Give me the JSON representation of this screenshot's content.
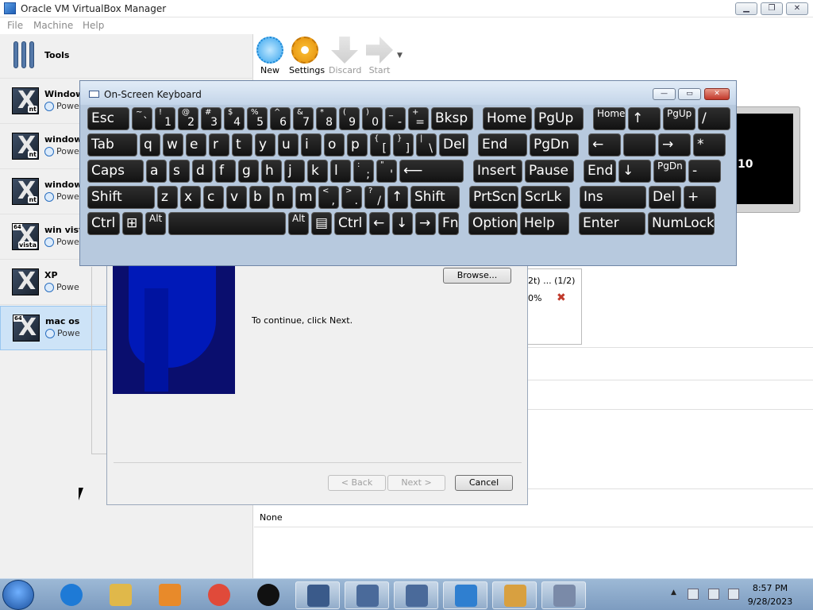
{
  "window": {
    "title": "Oracle VM VirtualBox Manager",
    "btn_min": "▁",
    "btn_max": "❐",
    "btn_close": "✕"
  },
  "menu": [
    "File",
    "Machine",
    "Help"
  ],
  "sidebar": {
    "tools_label": "Tools",
    "vms": [
      {
        "name": "Window",
        "state": "Powe",
        "badge": "nt",
        "bit": ""
      },
      {
        "name": "windows",
        "state": "Powe",
        "badge": "nt",
        "bit": ""
      },
      {
        "name": "windows",
        "state": "Powe",
        "badge": "nt",
        "bit": ""
      },
      {
        "name": "win vist",
        "state": "Powe",
        "badge": "vista",
        "bit": "64"
      },
      {
        "name": "XP",
        "state": "Powe",
        "badge": "",
        "bit": ""
      },
      {
        "name": "mac os",
        "state": "Powe",
        "badge": "",
        "bit": "64"
      }
    ]
  },
  "toolbar": {
    "new": "New",
    "settings": "Settings",
    "discard": "Discard",
    "start": "Start"
  },
  "preview": {
    "text": "10"
  },
  "downloads": {
    "progress_label": "2t) ... (1/2)",
    "percent": "0%",
    "cancel_icon": "✖"
  },
  "details": {
    "none_label": "None"
  },
  "wizard": {
    "browse": "Browse...",
    "instruction": "To continue, click Next.",
    "back": "< Back",
    "next": "Next >",
    "cancel": "Cancel"
  },
  "osk": {
    "title": "On-Screen Keyboard",
    "btn_min": "—",
    "btn_max": "▭",
    "btn_close": "✕",
    "row1": [
      {
        "t": "Esc"
      },
      {
        "sub": "~",
        "main": "`"
      },
      {
        "sub": "!",
        "main": "1"
      },
      {
        "sub": "@",
        "main": "2"
      },
      {
        "sub": "#",
        "main": "3"
      },
      {
        "sub": "$",
        "main": "4"
      },
      {
        "sub": "%",
        "main": "5"
      },
      {
        "sub": "^",
        "main": "6"
      },
      {
        "sub": "&",
        "main": "7"
      },
      {
        "sub": "*",
        "main": "8"
      },
      {
        "sub": "(",
        "main": "9"
      },
      {
        "sub": ")",
        "main": "0"
      },
      {
        "sub": "_",
        "main": "-"
      },
      {
        "sub": "+",
        "main": "="
      },
      {
        "t": "Bksp"
      },
      {
        "t": "Home"
      },
      {
        "t": "PgUp"
      },
      {
        "t": "Home",
        "sm": true
      },
      {
        "t": "↑"
      },
      {
        "t": "PgUp",
        "sm": true
      },
      {
        "t": "/"
      }
    ],
    "row2": [
      {
        "t": "Tab"
      },
      {
        "t": "q"
      },
      {
        "t": "w"
      },
      {
        "t": "e"
      },
      {
        "t": "r"
      },
      {
        "t": "t"
      },
      {
        "t": "y"
      },
      {
        "t": "u"
      },
      {
        "t": "i"
      },
      {
        "t": "o"
      },
      {
        "t": "p"
      },
      {
        "sub": "{",
        "main": "["
      },
      {
        "sub": "}",
        "main": "]"
      },
      {
        "sub": "|",
        "main": "\\"
      },
      {
        "t": "Del"
      },
      {
        "t": "End"
      },
      {
        "t": "PgDn"
      },
      {
        "t": "←"
      },
      {
        "t": ""
      },
      {
        "t": "→"
      },
      {
        "t": "*"
      }
    ],
    "row3": [
      {
        "t": "Caps"
      },
      {
        "t": "a"
      },
      {
        "t": "s"
      },
      {
        "t": "d"
      },
      {
        "t": "f"
      },
      {
        "t": "g"
      },
      {
        "t": "h"
      },
      {
        "t": "j"
      },
      {
        "t": "k"
      },
      {
        "t": "l"
      },
      {
        "sub": ":",
        "main": ";"
      },
      {
        "sub": "\"",
        "main": "'"
      },
      {
        "t": "⟵"
      },
      {
        "t": "Insert"
      },
      {
        "t": "Pause"
      },
      {
        "t": "End"
      },
      {
        "t": "↓"
      },
      {
        "t": "PgDn",
        "sm": true
      },
      {
        "t": "-"
      }
    ],
    "row4": [
      {
        "t": "Shift"
      },
      {
        "t": "z"
      },
      {
        "t": "x"
      },
      {
        "t": "c"
      },
      {
        "t": "v"
      },
      {
        "t": "b"
      },
      {
        "t": "n"
      },
      {
        "t": "m"
      },
      {
        "sub": "<",
        "main": ","
      },
      {
        "sub": ">",
        "main": "."
      },
      {
        "sub": "?",
        "main": "/"
      },
      {
        "t": "↑"
      },
      {
        "t": "Shift"
      },
      {
        "t": "PrtScn"
      },
      {
        "t": "ScrLk"
      },
      {
        "t": "Ins"
      },
      {
        "t": "Del"
      },
      {
        "t": "+"
      }
    ],
    "row5": [
      {
        "t": "Ctrl"
      },
      {
        "t": "⊞"
      },
      {
        "t": "Alt",
        "sm": true
      },
      {
        "t": ""
      },
      {
        "t": "Alt",
        "sm": true
      },
      {
        "t": "▤"
      },
      {
        "t": "Ctrl"
      },
      {
        "t": "←"
      },
      {
        "t": "↓"
      },
      {
        "t": "→"
      },
      {
        "t": "Fn"
      },
      {
        "t": "Options"
      },
      {
        "t": "Help"
      },
      {
        "t": "Enter"
      },
      {
        "t": "NumLock"
      }
    ]
  },
  "taskbar": {
    "time": "8:57 PM",
    "date": "9/28/2023",
    "tray_arrow": "▲",
    "apps": [
      "internet-explorer",
      "file-explorer",
      "media-player",
      "chrome",
      "screen-recorder",
      "virtualbox-shark",
      "virtualbox",
      "virtualbox",
      "remote-desktop",
      "users",
      "on-screen-keyboard"
    ]
  }
}
